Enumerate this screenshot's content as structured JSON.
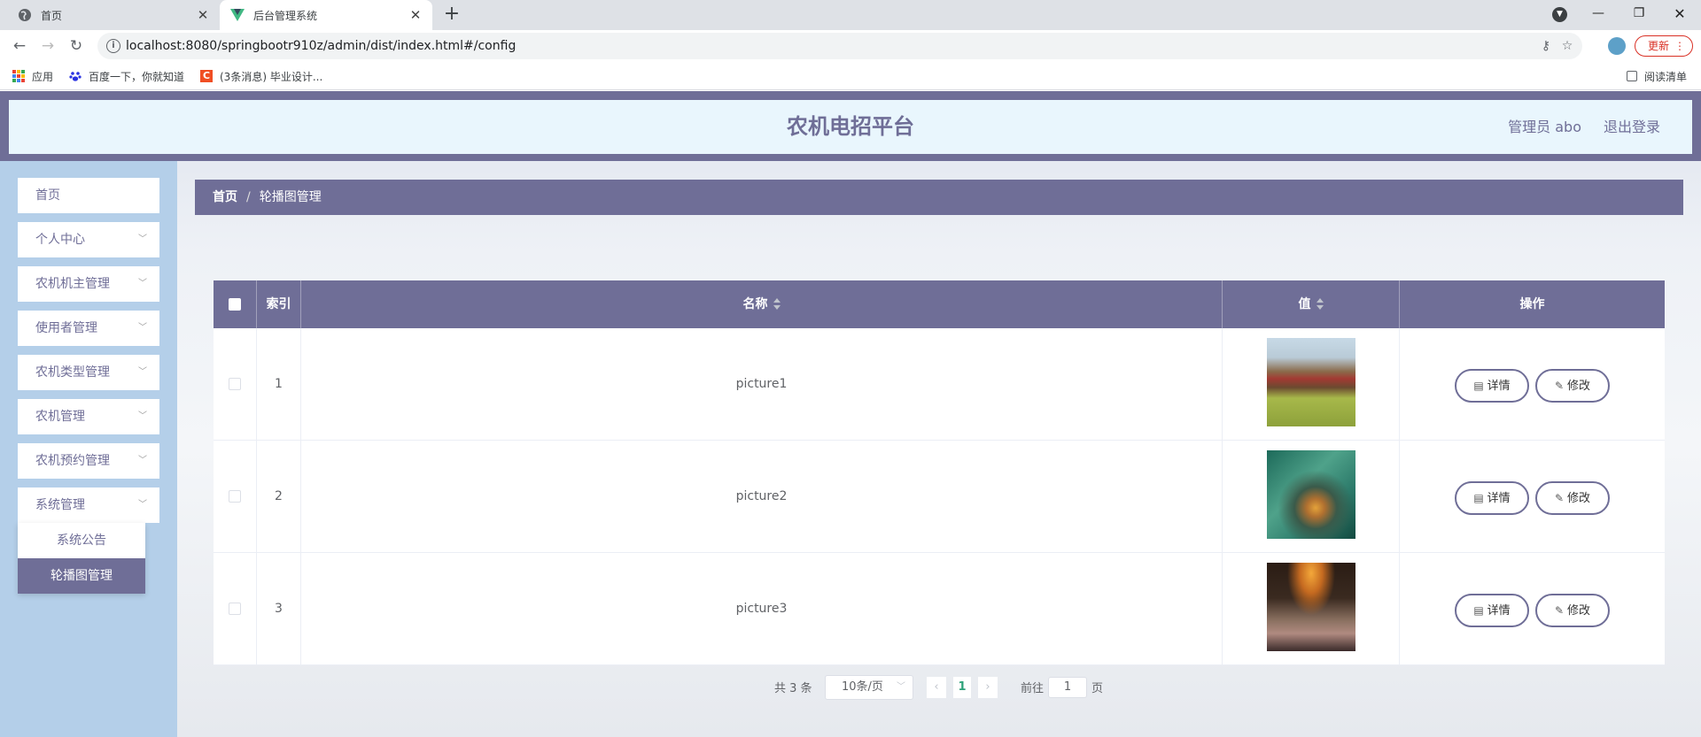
{
  "browser": {
    "tabs": [
      {
        "title": "首页",
        "active": false
      },
      {
        "title": "后台管理系统",
        "active": true
      }
    ],
    "url": "localhost:8080/springbootr910z/admin/dist/index.html#/config",
    "update_label": "更新",
    "bookmarks": [
      {
        "label": "应用"
      },
      {
        "label": "百度一下，你就知道"
      },
      {
        "label": "(3条消息) 毕业设计..."
      }
    ],
    "reading_list": "阅读清单"
  },
  "header": {
    "title": "农机电招平台",
    "user": "管理员 abo",
    "logout": "退出登录"
  },
  "sidebar": {
    "items": [
      {
        "label": "首页"
      },
      {
        "label": "个人中心"
      },
      {
        "label": "农机机主管理"
      },
      {
        "label": "使用者管理"
      },
      {
        "label": "农机类型管理"
      },
      {
        "label": "农机管理"
      },
      {
        "label": "农机预约管理"
      },
      {
        "label": "系统管理"
      }
    ],
    "submenu": [
      {
        "label": "系统公告",
        "active": false
      },
      {
        "label": "轮播图管理",
        "active": true
      }
    ]
  },
  "breadcrumb": {
    "home": "首页",
    "separator": "/",
    "current": "轮播图管理"
  },
  "table": {
    "headers": {
      "index": "索引",
      "name": "名称",
      "value": "值",
      "actions": "操作"
    },
    "rows": [
      {
        "index": "1",
        "name": "picture1",
        "detail": "详情",
        "edit": "修改"
      },
      {
        "index": "2",
        "name": "picture2",
        "detail": "详情",
        "edit": "修改"
      },
      {
        "index": "3",
        "name": "picture3",
        "detail": "详情",
        "edit": "修改"
      }
    ]
  },
  "pagination": {
    "total": "共 3 条",
    "page_size": "10条/页",
    "current_page": "1",
    "goto_prefix": "前往",
    "goto_value": "1",
    "goto_suffix": "页"
  },
  "colors": {
    "accent": "#6f6e97",
    "header_bg": "#e9f6fd",
    "sidebar_bg": "#b4cfe9",
    "active_page": "#2fa27a"
  }
}
